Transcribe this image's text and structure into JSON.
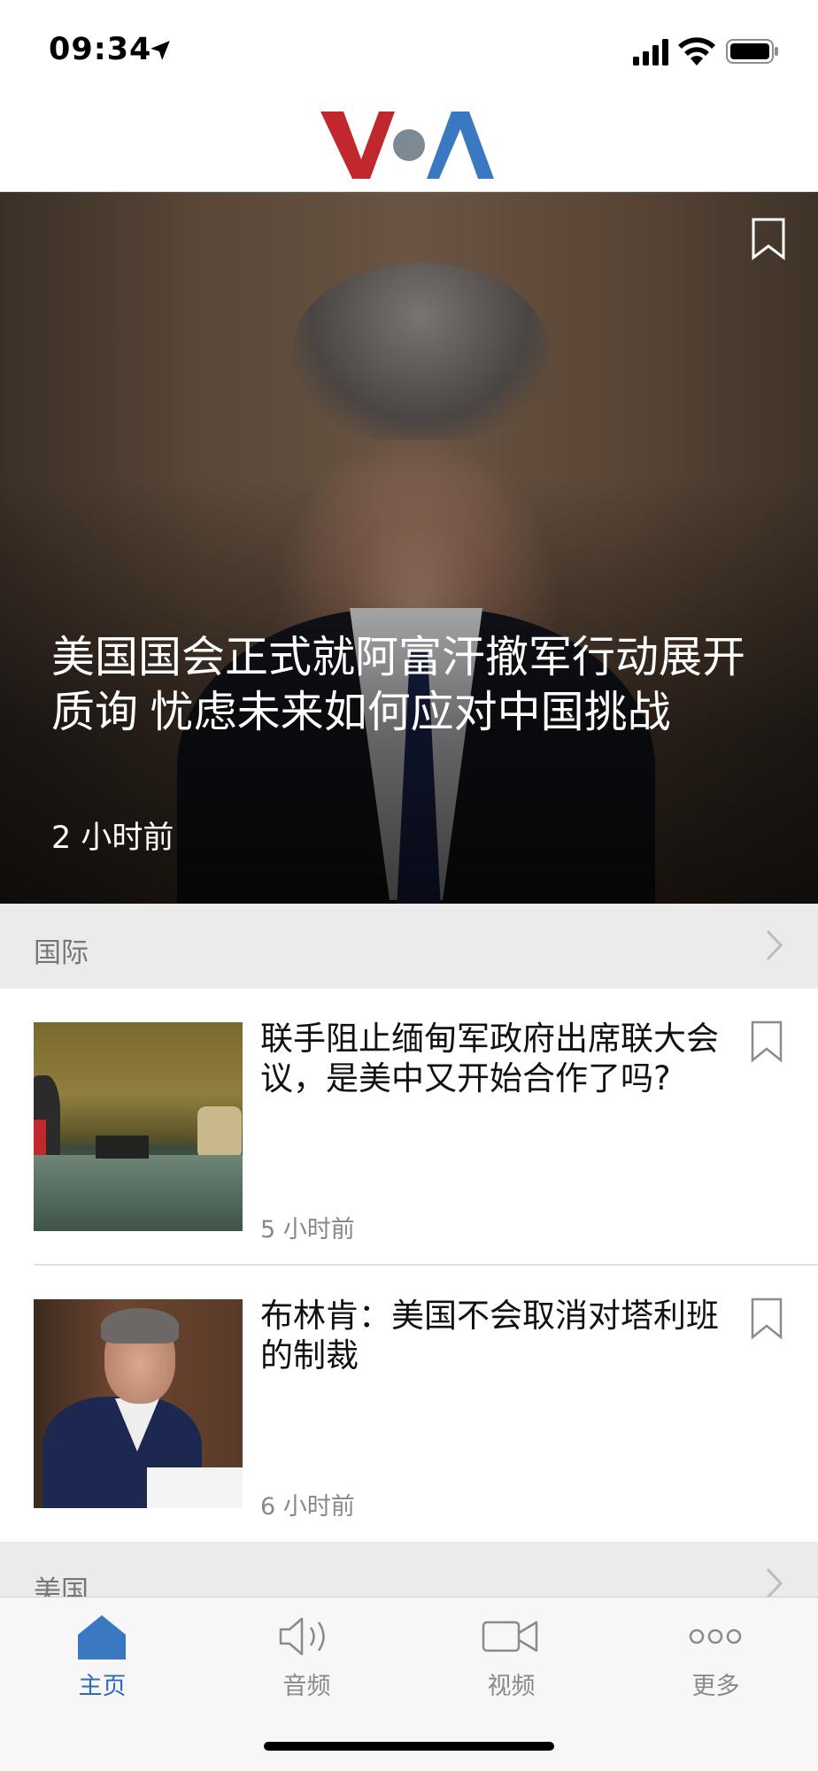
{
  "status_bar": {
    "time": "09:34"
  },
  "header": {
    "logo_text": "VOA"
  },
  "hero": {
    "title": "美国国会正式就阿富汗撤军行动展开质询 忧虑未来如何应对中国挑战",
    "time": "2 小时前"
  },
  "sections": [
    {
      "label": "国际"
    },
    {
      "label": "美国"
    }
  ],
  "articles": [
    {
      "title": "联手阻止缅甸军政府出席联大会议，是美中又开始合作了吗?",
      "time": "5 小时前"
    },
    {
      "title": "布林肯：美国不会取消对塔利班的制裁",
      "time": "6 小时前"
    }
  ],
  "tabbar": {
    "items": [
      {
        "label": "主页",
        "icon": "home-icon",
        "active": true
      },
      {
        "label": "音频",
        "icon": "speaker-icon",
        "active": false
      },
      {
        "label": "视频",
        "icon": "video-camera-icon",
        "active": false
      },
      {
        "label": "更多",
        "icon": "more-dots-icon",
        "active": false
      }
    ]
  },
  "colors": {
    "accent": "#2e6bb7",
    "logo_red": "#c0282d",
    "logo_blue": "#3b78c2",
    "logo_gray": "#7d8a94",
    "section_bg": "#ebebeb"
  }
}
